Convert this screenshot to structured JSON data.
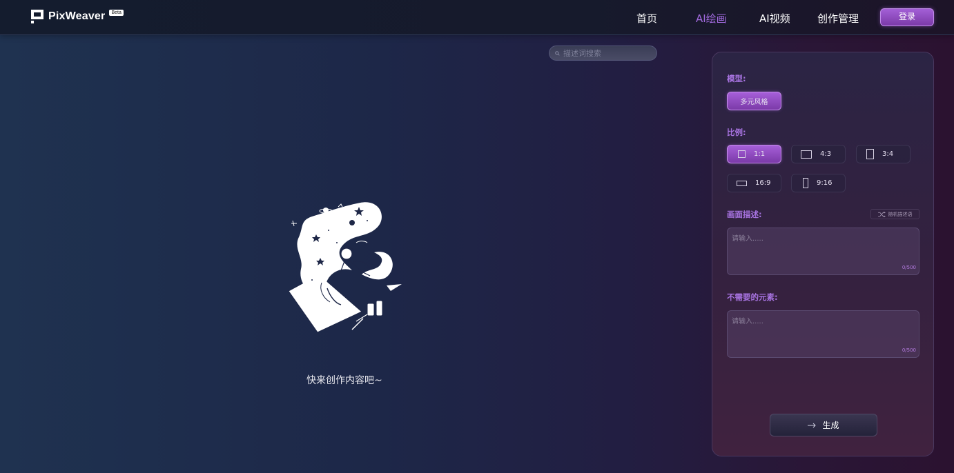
{
  "header": {
    "logo_text": "PixWeaver",
    "beta_badge": "Beta",
    "nav": [
      {
        "label": "首页",
        "active": false
      },
      {
        "label": "AI绘画",
        "active": true
      },
      {
        "label": "AI视频",
        "active": false
      },
      {
        "label": "创作管理",
        "active": false
      }
    ],
    "login_label": "登录"
  },
  "search": {
    "placeholder": "描述词搜索",
    "icon": "search-icon"
  },
  "main": {
    "empty_text": "快来创作内容吧~"
  },
  "panel": {
    "model_label": "模型:",
    "model_option": "多元风格",
    "ratio_label": "比例:",
    "ratios": [
      {
        "label": "1:1",
        "selected": true
      },
      {
        "label": "4:3",
        "selected": false
      },
      {
        "label": "3:4",
        "selected": false
      },
      {
        "label": "16:9",
        "selected": false
      },
      {
        "label": "9:16",
        "selected": false
      }
    ],
    "prompt_label": "画面描述:",
    "random_label": "随机描述语",
    "prompt_placeholder": "请输入.....",
    "prompt_counter": "0/500",
    "negative_label": "不需要的元素:",
    "negative_placeholder": "请输入.....",
    "negative_counter": "0/500",
    "generate_label": "生成"
  },
  "colors": {
    "accent": "#a36be0",
    "button_gradient_top": "#a65fd9",
    "button_gradient_bottom": "#7b3aa8"
  }
}
